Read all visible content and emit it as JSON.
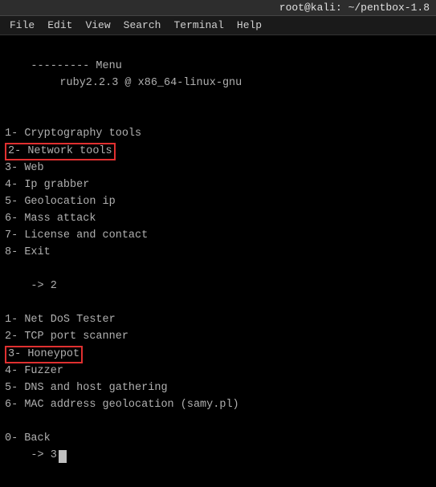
{
  "titlebar": {
    "text": "root@kali: ~/pentbox-1.8"
  },
  "menubar": {
    "items": [
      "File",
      "Edit",
      "View",
      "Search",
      "Terminal",
      "Help"
    ]
  },
  "terminal": {
    "header_divider": "--------- Menu",
    "header_ruby": "ruby2.2.3 @ x86_64-linux-gnu",
    "main_menu": [
      {
        "num": "1",
        "label": "Cryptography tools"
      },
      {
        "num": "2",
        "label": "Network tools",
        "highlighted": true
      },
      {
        "num": "3",
        "label": "Web"
      },
      {
        "num": "4",
        "label": "Ip grabber"
      },
      {
        "num": "5",
        "label": "Geolocation ip"
      },
      {
        "num": "6",
        "label": "Mass attack"
      },
      {
        "num": "7",
        "label": "License and contact"
      },
      {
        "num": "8",
        "label": "Exit"
      }
    ],
    "prompt1": "-> 2",
    "sub_menu": [
      {
        "num": "1",
        "label": "Net DoS Tester"
      },
      {
        "num": "2",
        "label": "TCP port scanner"
      },
      {
        "num": "3",
        "label": "Honeypot",
        "highlighted": true
      },
      {
        "num": "4",
        "label": "Fuzzer"
      },
      {
        "num": "5",
        "label": "DNS and host gathering"
      },
      {
        "num": "6",
        "label": "MAC address geolocation (samy.pl)"
      }
    ],
    "back_item": "0- Back",
    "prompt2": "-> 3"
  }
}
